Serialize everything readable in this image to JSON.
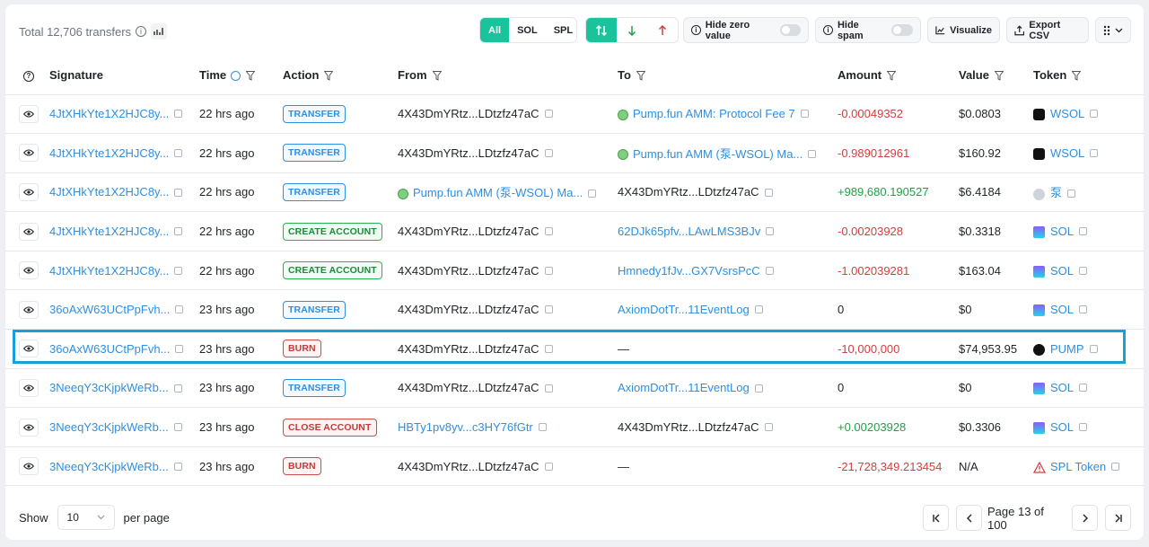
{
  "header": {
    "total": "Total 12,706 transfers",
    "filters": [
      "All",
      "SOL",
      "SPL"
    ],
    "hide_zero_label": "Hide zero value",
    "hide_spam_label": "Hide spam",
    "visualize_label": "Visualize",
    "export_label": "Export CSV"
  },
  "columns": [
    "Signature",
    "Time",
    "Action",
    "From",
    "To",
    "Amount",
    "Value",
    "Token"
  ],
  "rows": [
    {
      "sig": "4JtXHkYte1X2HJC8y...",
      "time": "22 hrs ago",
      "action": "TRANSFER",
      "action_type": "transfer",
      "from": "4X43DmYRtz...LDtzfz47aC",
      "from_link": false,
      "from_pill": false,
      "to": "Pump.fun AMM: Protocol Fee 7",
      "to_link": true,
      "to_pill": true,
      "amount": "-0.00049352",
      "amount_sign": "neg",
      "value": "$0.0803",
      "token": "WSOL",
      "token_icon": "wsol"
    },
    {
      "sig": "4JtXHkYte1X2HJC8y...",
      "time": "22 hrs ago",
      "action": "TRANSFER",
      "action_type": "transfer",
      "from": "4X43DmYRtz...LDtzfz47aC",
      "from_link": false,
      "from_pill": false,
      "to": "Pump.fun AMM (泵-WSOL) Ma...",
      "to_link": true,
      "to_pill": true,
      "amount": "-0.989012961",
      "amount_sign": "neg",
      "value": "$160.92",
      "token": "WSOL",
      "token_icon": "wsol"
    },
    {
      "sig": "4JtXHkYte1X2HJC8y...",
      "time": "22 hrs ago",
      "action": "TRANSFER",
      "action_type": "transfer",
      "from": "Pump.fun AMM (泵-WSOL) Ma...",
      "from_link": true,
      "from_pill": true,
      "to": "4X43DmYRtz...LDtzfz47aC",
      "to_link": false,
      "to_pill": false,
      "amount": "+989,680.190527",
      "amount_sign": "pos",
      "value": "$6.4184",
      "token": "泵",
      "token_icon": "gray"
    },
    {
      "sig": "4JtXHkYte1X2HJC8y...",
      "time": "22 hrs ago",
      "action": "CREATE ACCOUNT",
      "action_type": "create",
      "from": "4X43DmYRtz...LDtzfz47aC",
      "from_link": false,
      "from_pill": false,
      "to": "62DJk65pfv...LAwLMS3BJv",
      "to_link": true,
      "to_pill": false,
      "amount": "-0.00203928",
      "amount_sign": "neg",
      "value": "$0.3318",
      "token": "SOL",
      "token_icon": "sol"
    },
    {
      "sig": "4JtXHkYte1X2HJC8y...",
      "time": "22 hrs ago",
      "action": "CREATE ACCOUNT",
      "action_type": "create",
      "from": "4X43DmYRtz...LDtzfz47aC",
      "from_link": false,
      "from_pill": false,
      "to": "Hmnedy1fJv...GX7VsrsPcC",
      "to_link": true,
      "to_pill": false,
      "amount": "-1.002039281",
      "amount_sign": "neg",
      "value": "$163.04",
      "token": "SOL",
      "token_icon": "sol"
    },
    {
      "sig": "36oAxW63UCtPpFvh...",
      "time": "23 hrs ago",
      "action": "TRANSFER",
      "action_type": "transfer",
      "from": "4X43DmYRtz...LDtzfz47aC",
      "from_link": false,
      "from_pill": false,
      "to": "AxiomDotTr...11EventLog",
      "to_link": true,
      "to_pill": false,
      "amount": "0",
      "amount_sign": "zero",
      "value": "$0",
      "token": "SOL",
      "token_icon": "sol"
    },
    {
      "sig": "36oAxW63UCtPpFvh...",
      "time": "23 hrs ago",
      "action": "BURN",
      "action_type": "burn",
      "from": "4X43DmYRtz...LDtzfz47aC",
      "from_link": false,
      "from_pill": false,
      "to": "—",
      "to_link": false,
      "to_pill": false,
      "amount": "-10,000,000",
      "amount_sign": "neg",
      "value": "$74,953.95",
      "token": "PUMP",
      "token_icon": "pump"
    },
    {
      "sig": "3NeeqY3cKjpkWeRb...",
      "time": "23 hrs ago",
      "action": "TRANSFER",
      "action_type": "transfer",
      "from": "4X43DmYRtz...LDtzfz47aC",
      "from_link": false,
      "from_pill": false,
      "to": "AxiomDotTr...11EventLog",
      "to_link": true,
      "to_pill": false,
      "amount": "0",
      "amount_sign": "zero",
      "value": "$0",
      "token": "SOL",
      "token_icon": "sol"
    },
    {
      "sig": "3NeeqY3cKjpkWeRb...",
      "time": "23 hrs ago",
      "action": "CLOSE ACCOUNT",
      "action_type": "burn",
      "from": "HBTy1pv8yv...c3HY76fGtr",
      "from_link": true,
      "from_pill": false,
      "to": "4X43DmYRtz...LDtzfz47aC",
      "to_link": false,
      "to_pill": false,
      "amount": "+0.00203928",
      "amount_sign": "pos",
      "value": "$0.3306",
      "token": "SOL",
      "token_icon": "sol"
    },
    {
      "sig": "3NeeqY3cKjpkWeRb...",
      "time": "23 hrs ago",
      "action": "BURN",
      "action_type": "burn",
      "from": "4X43DmYRtz...LDtzfz47aC",
      "from_link": false,
      "from_pill": false,
      "to": "—",
      "to_link": false,
      "to_pill": false,
      "amount": "-21,728,349.213454",
      "amount_sign": "neg",
      "value": "N/A",
      "token": "SPL Token",
      "token_icon": "warn"
    }
  ],
  "footer": {
    "show_label": "Show",
    "page_size": "10",
    "per_page_label": "per page",
    "page_info": "Page 13 of 100"
  }
}
